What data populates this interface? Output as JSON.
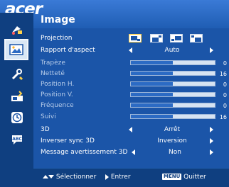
{
  "header": {
    "logo": "acer",
    "title": "Image"
  },
  "sidebar": {
    "items": [
      {
        "icon": "color-management-icon",
        "selected": false
      },
      {
        "icon": "image-settings-icon",
        "selected": true
      },
      {
        "icon": "tools-settings-icon",
        "selected": false
      },
      {
        "icon": "management-icon",
        "selected": false
      },
      {
        "icon": "timer-icon",
        "selected": false
      },
      {
        "icon": "language-abc-icon",
        "selected": false
      }
    ]
  },
  "menu": {
    "projection": {
      "label": "Projection",
      "icons": [
        "front-desk-icon",
        "front-ceiling-icon",
        "rear-desk-icon",
        "rear-ceiling-icon"
      ],
      "selected_index": 0
    },
    "aspect": {
      "label": "Rapport d'aspect",
      "value": "Auto"
    },
    "sliders": [
      {
        "label": "Trapèze",
        "value": "0",
        "level": 0.5
      },
      {
        "label": "Netteté",
        "value": "16",
        "level": 0.5
      },
      {
        "label": "Position H.",
        "value": "0",
        "level": 0.5
      },
      {
        "label": "Position V.",
        "value": "0",
        "level": 0.5
      },
      {
        "label": "Fréquence",
        "value": "0",
        "level": 0.5
      },
      {
        "label": "Suivi",
        "value": "16",
        "level": 0.5
      }
    ],
    "three_d": {
      "label": "3D",
      "value": "Arrêt"
    },
    "sync_3d": {
      "label": "Inverser sync 3D",
      "value": "Inversion"
    },
    "warning_3d": {
      "label": "Message avertissement 3D",
      "value": "Non"
    }
  },
  "footer": {
    "select_label": "Sélectionner",
    "enter_label": "Entrer",
    "menu_key": "MENU",
    "quit_label": "Quitter"
  }
}
